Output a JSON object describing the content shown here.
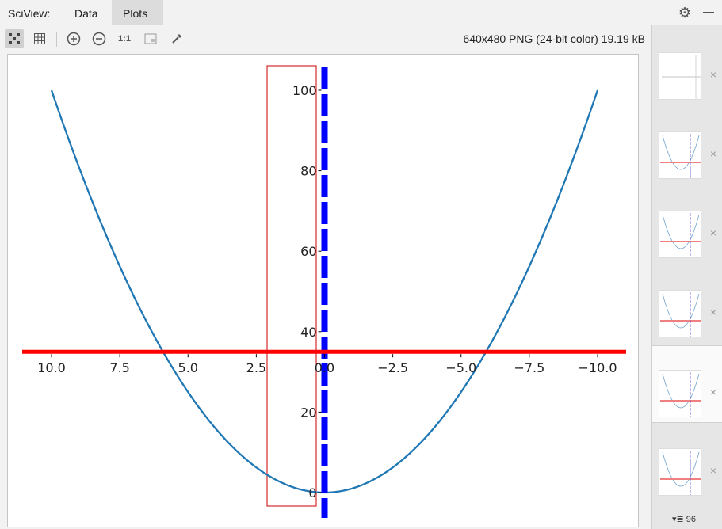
{
  "panel": {
    "title": "SciView:",
    "tabs": [
      {
        "label": "Data"
      },
      {
        "label": "Plots"
      }
    ]
  },
  "toolbar": {
    "image_info": "640x480 PNG (24-bit color) 19.19 kB",
    "icons": [
      "fit-icon",
      "grid-icon",
      "zoom-in-icon",
      "zoom-out-icon",
      "actual-size-icon",
      "image-icon",
      "color-picker-icon"
    ],
    "actual_size_label": "1:1"
  },
  "thumbnails": {
    "count_label": "96",
    "items": [
      {
        "selected": false
      },
      {
        "selected": false
      },
      {
        "selected": false
      },
      {
        "selected": false
      },
      {
        "selected": true
      },
      {
        "selected": false
      }
    ]
  },
  "chart_data": {
    "type": "line",
    "title": "",
    "xlabel": "",
    "ylabel": "",
    "xlim": [
      11.0,
      -11.0
    ],
    "ylim": [
      -3,
      106
    ],
    "x_ticks": [
      "10.0",
      "7.5",
      "5.0",
      "2.5",
      "0.0",
      "−2.5",
      "−5.0",
      "−7.5",
      "−10.0"
    ],
    "x_tick_values": [
      10,
      7.5,
      5,
      2.5,
      0,
      -2.5,
      -5,
      -7.5,
      -10
    ],
    "y_ticks": [
      "0",
      "20",
      "40",
      "60",
      "80",
      "100"
    ],
    "y_tick_values": [
      0,
      20,
      40,
      60,
      80,
      100
    ],
    "x_axis_at_y": 35,
    "y_axis_at_x": 0,
    "series": [
      {
        "function": "y = x^2",
        "x": [
          -10,
          -8,
          -6,
          -4,
          -2,
          0,
          2,
          4,
          6,
          8,
          10
        ],
        "y": [
          100,
          64,
          36,
          16,
          4,
          0,
          4,
          16,
          36,
          64,
          100
        ],
        "color": "#1f77b4"
      }
    ],
    "spines": {
      "bottom": {
        "color": "#ff0000",
        "position_y": 35
      },
      "left": {
        "color": "#0000ff",
        "style": "dashed",
        "position_x": 0
      }
    },
    "highlight_box_color": "#cc0000"
  }
}
